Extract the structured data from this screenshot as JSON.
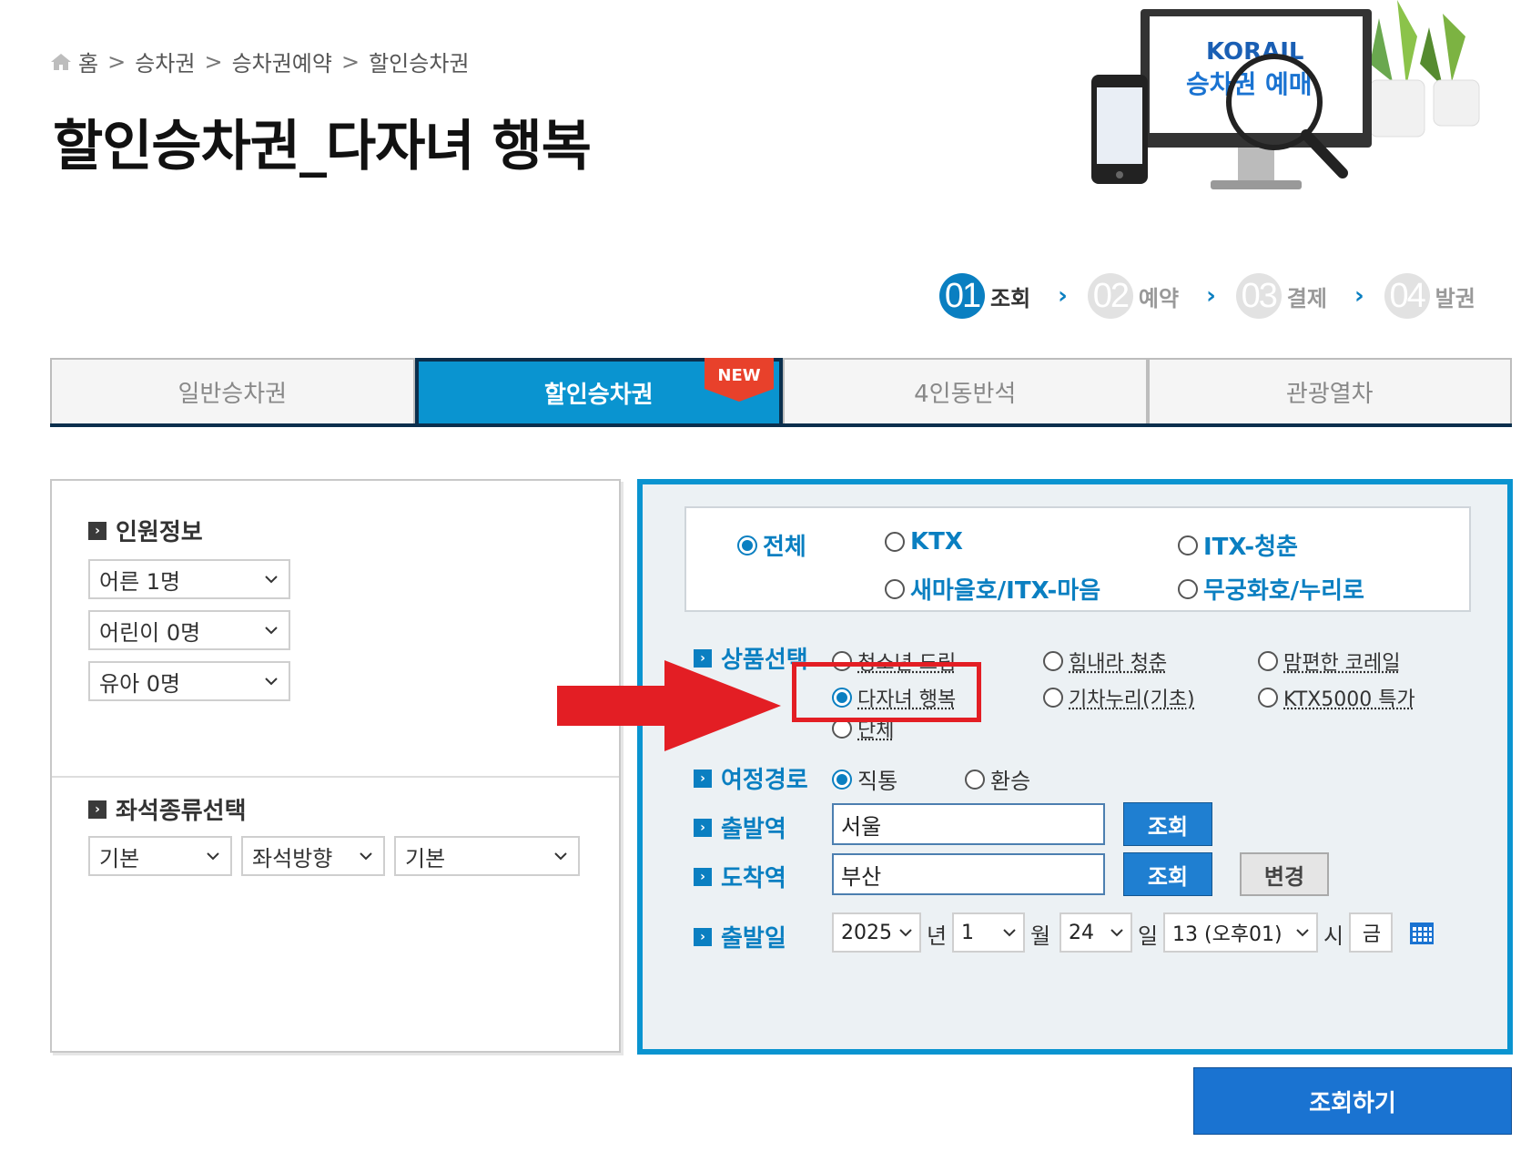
{
  "breadcrumb": {
    "items": [
      "홈",
      "승차권",
      "승차권예약",
      "할인승차권"
    ],
    "separator": ">"
  },
  "page_title": "할인승차권_다자녀 행복",
  "illustration": {
    "brand": "KORAIL",
    "caption": "승차권 예매"
  },
  "steps": [
    {
      "num": "01",
      "label": "조회",
      "active": true
    },
    {
      "num": "02",
      "label": "예약",
      "active": false
    },
    {
      "num": "03",
      "label": "결제",
      "active": false
    },
    {
      "num": "04",
      "label": "발권",
      "active": false
    }
  ],
  "tabs": [
    {
      "label": "일반승차권",
      "active": false
    },
    {
      "label": "할인승차권",
      "active": true,
      "badge": "NEW"
    },
    {
      "label": "4인동반석",
      "active": false
    },
    {
      "label": "관광열차",
      "active": false
    }
  ],
  "passenger": {
    "heading": "인원정보",
    "adult": "어른 1명",
    "child": "어린이 0명",
    "infant": "유아 0명"
  },
  "seat": {
    "heading": "좌석종류선택",
    "type": "기본",
    "direction": "좌석방향",
    "extra": "기본"
  },
  "train_types": {
    "all": "전체",
    "ktx": "KTX",
    "itx_cheongchun": "ITX-청춘",
    "saemaeul": "새마을호/ITX-마음",
    "mugunghwa": "무궁화호/누리로",
    "selected": "전체"
  },
  "product": {
    "label": "상품선택",
    "options": {
      "youth_dream": "청소년 드림",
      "cheer_up": "힘내라 청춘",
      "comfort": "맘편한 코레일",
      "multi_child": "다자녀 행복",
      "gicha_nuri": "기차누리(기초)",
      "ktx5000": "KTX5000 특가",
      "group": "단체"
    },
    "selected": "다자녀 행복"
  },
  "route": {
    "label": "여정경로",
    "direct": "직통",
    "transfer": "환승",
    "selected": "직통"
  },
  "departure": {
    "label": "출발역",
    "value": "서울",
    "lookup": "조회"
  },
  "arrival": {
    "label": "도착역",
    "value": "부산",
    "lookup": "조회",
    "swap": "변경"
  },
  "date": {
    "label": "출발일",
    "year": "2025",
    "year_unit": "년",
    "month": "1",
    "month_unit": "월",
    "day": "24",
    "day_unit": "일",
    "hour": "13 (오후01)",
    "hour_unit": "시",
    "weekday": "금"
  },
  "search_button": "조회하기",
  "colors": {
    "accent": "#0a94d0",
    "dark_navy": "#0b2f4d",
    "highlight": "#e31e24",
    "button_blue": "#1a73d1"
  }
}
